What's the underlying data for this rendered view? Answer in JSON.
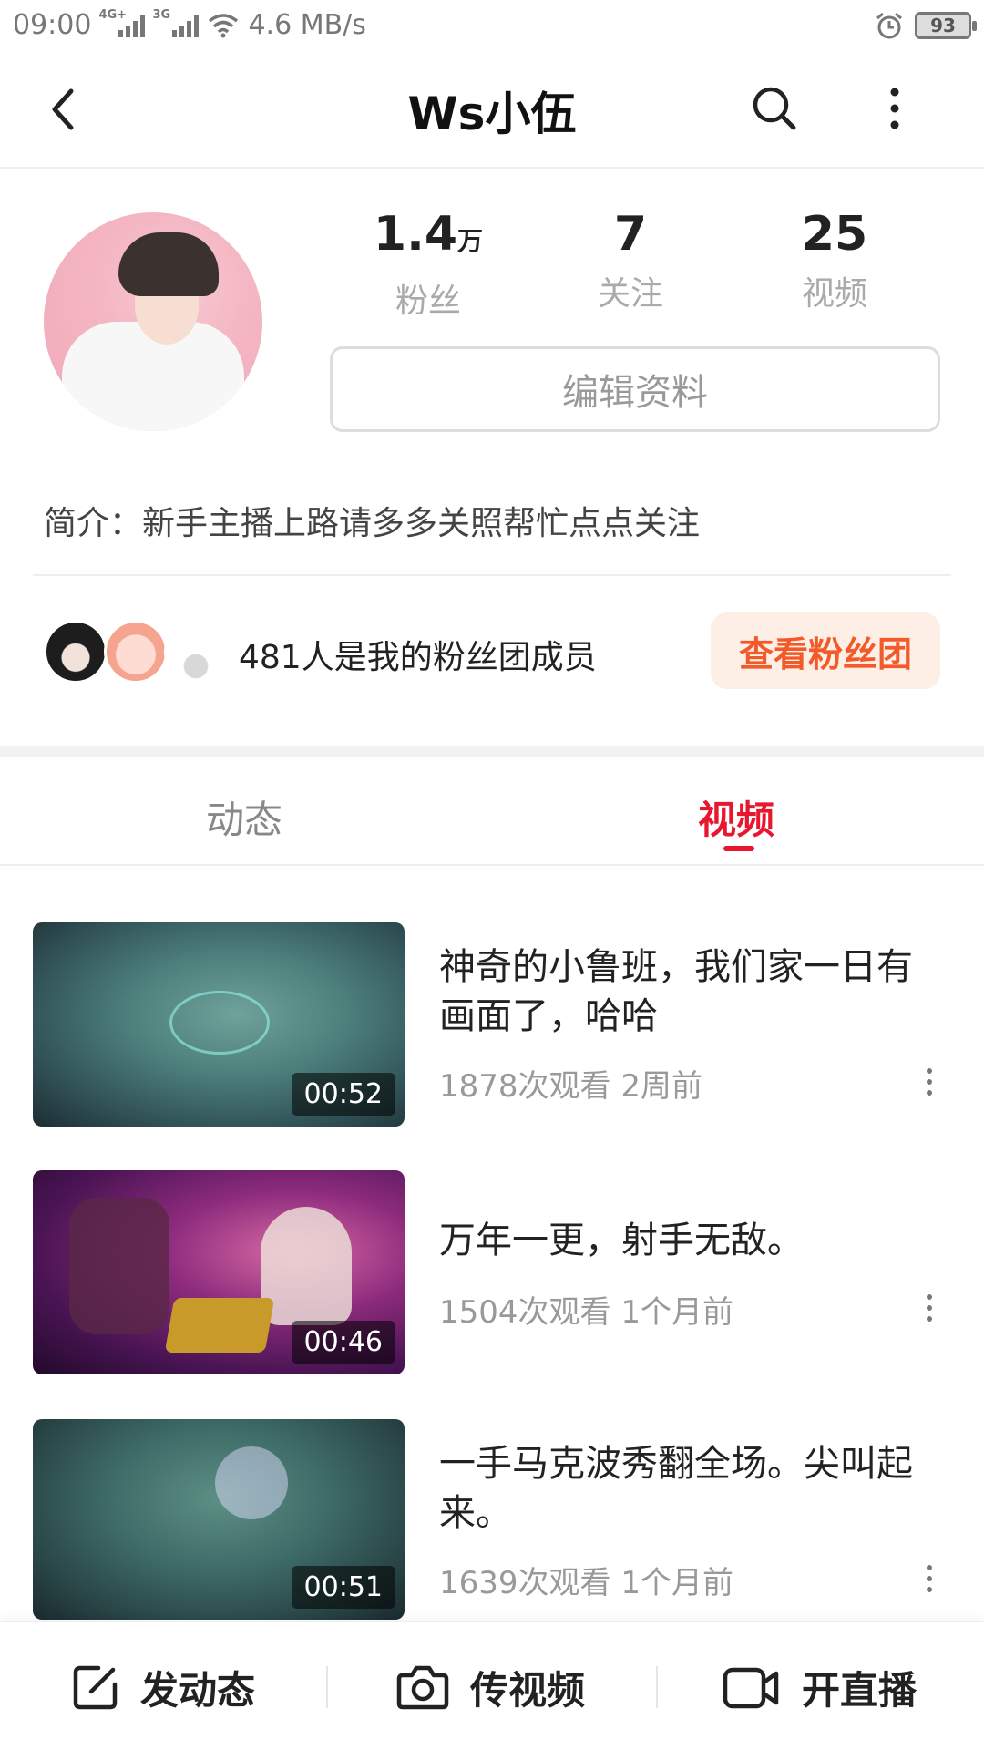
{
  "status_bar": {
    "time": "09:00",
    "net1": "4G+",
    "net2": "3G",
    "speed": "4.6 MB/s",
    "battery": "93"
  },
  "header": {
    "title": "Ws小伍"
  },
  "profile": {
    "stats": [
      {
        "num": "1.4",
        "unit": "万",
        "label": "粉丝"
      },
      {
        "num": "7",
        "unit": "",
        "label": "关注"
      },
      {
        "num": "25",
        "unit": "",
        "label": "视频"
      }
    ],
    "edit_label": "编辑资料",
    "intro": "简介：新手主播上路请多多关照帮忙点点关注",
    "fan_text": "481人是我的粉丝团成员",
    "fan_button": "查看粉丝团"
  },
  "tabs": [
    {
      "label": "动态"
    },
    {
      "label": "视频"
    }
  ],
  "videos": [
    {
      "title": "神奇的小鲁班，我们家一日有画面了，哈哈",
      "views": "1878次观看",
      "time": "2周前",
      "duration": "00:52"
    },
    {
      "title": "万年一更，射手无敌。",
      "views": "1504次观看",
      "time": "1个月前",
      "duration": "00:46"
    },
    {
      "title": "一手马克波秀翻全场。尖叫起来。",
      "views": "1639次观看",
      "time": "1个月前",
      "duration": "00:51"
    }
  ],
  "bottom_bar": {
    "post": "发动态",
    "upload": "传视频",
    "live": "开直播"
  },
  "colors": {
    "accent": "#e8162f",
    "fan_button_text": "#f25a2a",
    "fan_button_bg": "#fdeee6"
  }
}
